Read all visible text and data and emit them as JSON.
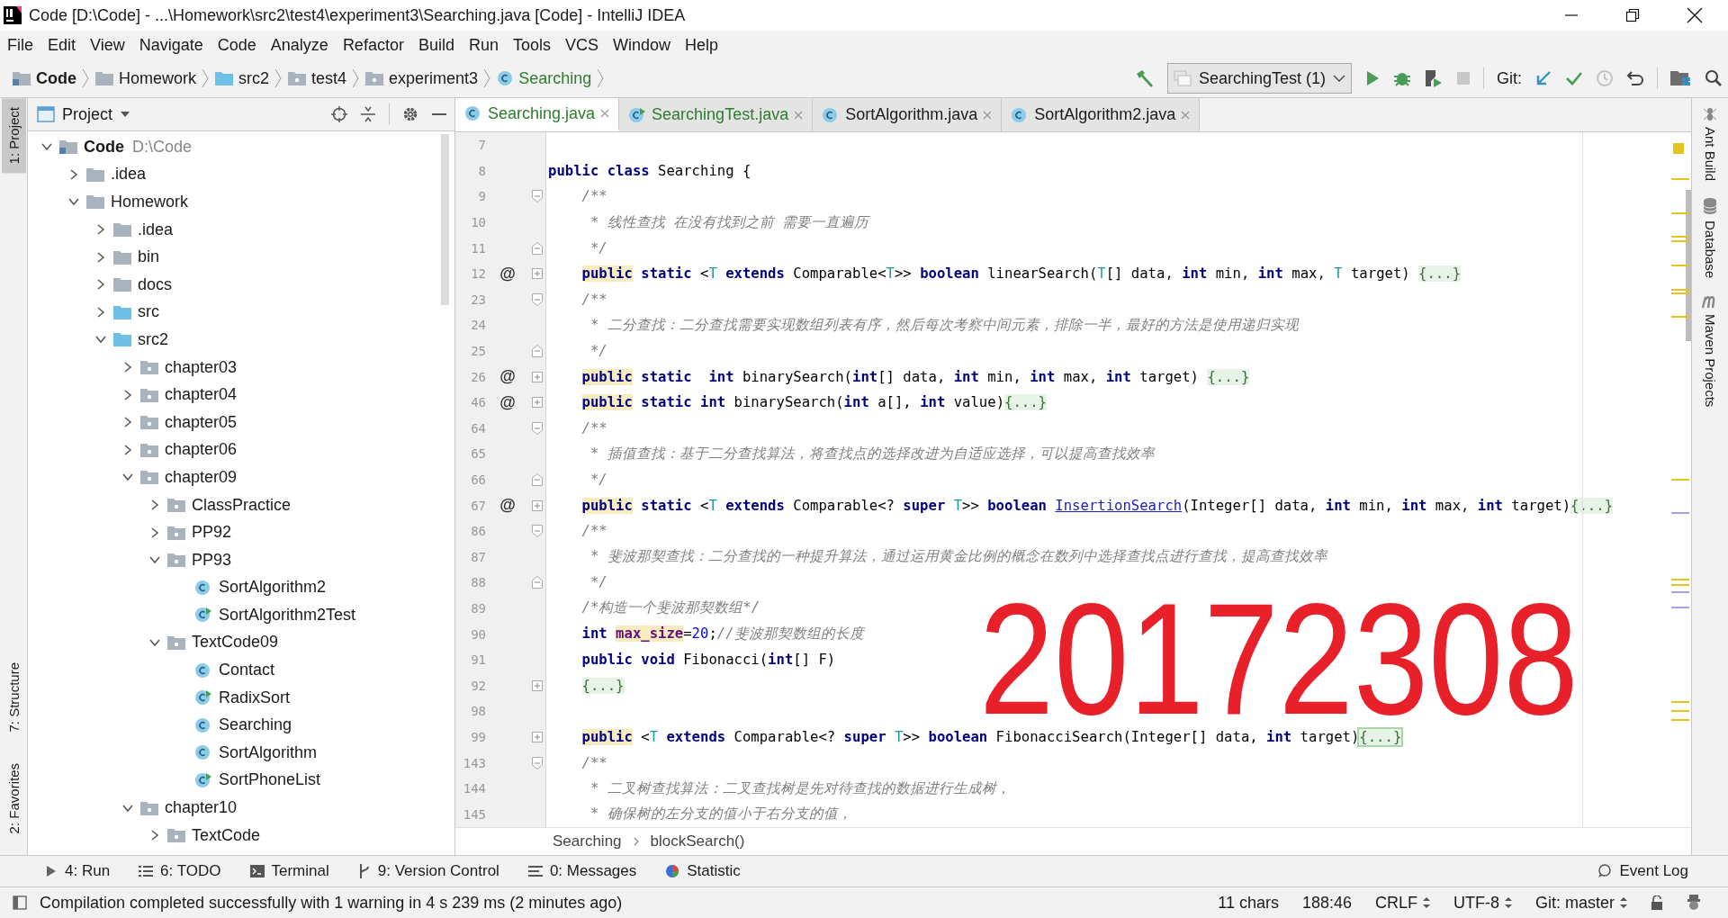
{
  "window": {
    "title": "Code [D:\\Code] - ...\\Homework\\src2\\test4\\experiment3\\Searching.java [Code] - IntelliJ IDEA"
  },
  "menu": [
    "File",
    "Edit",
    "View",
    "Navigate",
    "Code",
    "Analyze",
    "Refactor",
    "Build",
    "Run",
    "Tools",
    "VCS",
    "Window",
    "Help"
  ],
  "nav": {
    "crumbs": [
      {
        "label": "Code",
        "kind": "module"
      },
      {
        "label": "Homework",
        "kind": "folder"
      },
      {
        "label": "src2",
        "kind": "source"
      },
      {
        "label": "test4",
        "kind": "package"
      },
      {
        "label": "experiment3",
        "kind": "package"
      },
      {
        "label": "Searching",
        "kind": "class"
      }
    ],
    "run_config": "SearchingTest (1)",
    "git_label": "Git:"
  },
  "left_tools": [
    {
      "label": "1: Project",
      "selected": true
    },
    {
      "label": "7: Structure",
      "selected": false
    },
    {
      "label": "2: Favorites",
      "selected": false
    }
  ],
  "right_tools": [
    {
      "label": "Ant Build",
      "kind": "ant"
    },
    {
      "label": "Database",
      "kind": "database"
    },
    {
      "label": "Maven Projects",
      "kind": "maven"
    }
  ],
  "project": {
    "title": "Project",
    "tree": [
      {
        "label": "Code",
        "path": "D:\\Code",
        "kind": "module",
        "expanded": true,
        "children": [
          {
            "label": ".idea",
            "kind": "folder",
            "expanded": false
          },
          {
            "label": "Homework",
            "kind": "folder",
            "expanded": true,
            "children": [
              {
                "label": ".idea",
                "kind": "folder",
                "expanded": false
              },
              {
                "label": "bin",
                "kind": "folder",
                "expanded": false
              },
              {
                "label": "docs",
                "kind": "folder",
                "expanded": false
              },
              {
                "label": "src",
                "kind": "source",
                "expanded": false
              },
              {
                "label": "src2",
                "kind": "source",
                "expanded": true,
                "children": [
                  {
                    "label": "chapter03",
                    "kind": "package",
                    "expanded": false
                  },
                  {
                    "label": "chapter04",
                    "kind": "package",
                    "expanded": false
                  },
                  {
                    "label": "chapter05",
                    "kind": "package",
                    "expanded": false
                  },
                  {
                    "label": "chapter06",
                    "kind": "package",
                    "expanded": false
                  },
                  {
                    "label": "chapter09",
                    "kind": "package",
                    "expanded": true,
                    "children": [
                      {
                        "label": "ClassPractice",
                        "kind": "package",
                        "expanded": false
                      },
                      {
                        "label": "PP92",
                        "kind": "package",
                        "expanded": false
                      },
                      {
                        "label": "PP93",
                        "kind": "package",
                        "expanded": true,
                        "children": [
                          {
                            "label": "SortAlgorithm2",
                            "kind": "class"
                          },
                          {
                            "label": "SortAlgorithm2Test",
                            "kind": "test"
                          }
                        ]
                      },
                      {
                        "label": "TextCode09",
                        "kind": "package",
                        "expanded": true,
                        "children": [
                          {
                            "label": "Contact",
                            "kind": "class"
                          },
                          {
                            "label": "RadixSort",
                            "kind": "test"
                          },
                          {
                            "label": "Searching",
                            "kind": "class"
                          },
                          {
                            "label": "SortAlgorithm",
                            "kind": "class"
                          },
                          {
                            "label": "SortPhoneList",
                            "kind": "test"
                          }
                        ]
                      }
                    ]
                  },
                  {
                    "label": "chapter10",
                    "kind": "package",
                    "expanded": true,
                    "children": [
                      {
                        "label": "TextCode",
                        "kind": "package",
                        "expanded": false
                      }
                    ]
                  }
                ]
              }
            ]
          }
        ]
      }
    ]
  },
  "tabs": [
    {
      "label": "Searching.java",
      "kind": "class",
      "added": true,
      "selected": true
    },
    {
      "label": "SearchingTest.java",
      "kind": "test",
      "added": true,
      "selected": false
    },
    {
      "label": "SortAlgorithm.java",
      "kind": "class",
      "added": false,
      "selected": false
    },
    {
      "label": "SortAlgorithm2.java",
      "kind": "class",
      "added": false,
      "selected": false
    }
  ],
  "code": [
    {
      "n": "7",
      "kind": "plain"
    },
    {
      "n": "8",
      "kind": "plain",
      "indented": false,
      "tokens": [
        {
          "kind": "kw",
          "t": "public class"
        },
        {
          "kind": "tx",
          "t": " Searching {"
        }
      ]
    },
    {
      "n": "9",
      "kind": "fold-start",
      "indented": true,
      "tokens": [
        {
          "kind": "cm",
          "t": "/**"
        }
      ]
    },
    {
      "n": "10",
      "kind": "plain",
      "indented": true,
      "tokens": [
        {
          "kind": "cm",
          "t": " * 线性查找 在没有找到之前 需要一直遍历"
        }
      ]
    },
    {
      "n": "11",
      "kind": "fold-end",
      "indented": true,
      "tokens": [
        {
          "kind": "cm",
          "t": " */"
        }
      ]
    },
    {
      "n": "12",
      "mark": "@",
      "kind": "folded",
      "indented": true,
      "tokens": [
        {
          "kind": "kwh",
          "t": "public"
        },
        {
          "kind": "kw",
          "t": " static"
        },
        {
          "kind": "tx",
          "t": " <"
        },
        {
          "kind": "tp",
          "t": "T"
        },
        {
          "kind": "kw",
          "t": " extends"
        },
        {
          "kind": "tx",
          "t": " Comparable<"
        },
        {
          "kind": "tp",
          "t": "T"
        },
        {
          "kind": "tx",
          "t": ">> "
        },
        {
          "kind": "kw",
          "t": "boolean"
        },
        {
          "kind": "tx",
          "t": " linearSearch("
        },
        {
          "kind": "tp",
          "t": "T"
        },
        {
          "kind": "tx",
          "t": "[] data, "
        },
        {
          "kind": "kw",
          "t": "int"
        },
        {
          "kind": "tx",
          "t": " min, "
        },
        {
          "kind": "kw",
          "t": "int"
        },
        {
          "kind": "tx",
          "t": " max, "
        },
        {
          "kind": "tp",
          "t": "T"
        },
        {
          "kind": "tx",
          "t": " target) "
        },
        {
          "kind": "fold",
          "t": "{...}"
        }
      ]
    },
    {
      "n": "23",
      "kind": "fold-start",
      "indented": true,
      "tokens": [
        {
          "kind": "cm",
          "t": "/**"
        }
      ]
    },
    {
      "n": "24",
      "kind": "plain",
      "indented": true,
      "tokens": [
        {
          "kind": "cm",
          "t": " * 二分查找：二分查找需要实现数组列表有序，然后每次考察中间元素，排除一半，最好的方法是使用递归实现"
        }
      ]
    },
    {
      "n": "25",
      "kind": "fold-end",
      "indented": true,
      "tokens": [
        {
          "kind": "cm",
          "t": " */"
        }
      ]
    },
    {
      "n": "26",
      "mark": "@",
      "kind": "folded",
      "indented": true,
      "tokens": [
        {
          "kind": "kwh",
          "t": "public"
        },
        {
          "kind": "kw",
          "t": " static  int"
        },
        {
          "kind": "tx",
          "t": " binarySearch("
        },
        {
          "kind": "kw",
          "t": "int"
        },
        {
          "kind": "tx",
          "t": "[] data, "
        },
        {
          "kind": "kw",
          "t": "int"
        },
        {
          "kind": "tx",
          "t": " min, "
        },
        {
          "kind": "kw",
          "t": "int"
        },
        {
          "kind": "tx",
          "t": " max, "
        },
        {
          "kind": "kw",
          "t": "int"
        },
        {
          "kind": "tx",
          "t": " target) "
        },
        {
          "kind": "fold",
          "t": "{...}"
        }
      ]
    },
    {
      "n": "46",
      "mark": "@",
      "kind": "folded",
      "indented": true,
      "tokens": [
        {
          "kind": "kwh",
          "t": "public"
        },
        {
          "kind": "kw",
          "t": " static int"
        },
        {
          "kind": "tx",
          "t": " binarySearch("
        },
        {
          "kind": "kw",
          "t": "int"
        },
        {
          "kind": "tx",
          "t": " a[], "
        },
        {
          "kind": "kw",
          "t": "int"
        },
        {
          "kind": "tx",
          "t": " value)"
        },
        {
          "kind": "fold",
          "t": "{...}"
        }
      ]
    },
    {
      "n": "64",
      "kind": "fold-start",
      "indented": true,
      "tokens": [
        {
          "kind": "cm",
          "t": "/**"
        }
      ]
    },
    {
      "n": "65",
      "kind": "plain",
      "indented": true,
      "tokens": [
        {
          "kind": "cm",
          "t": " * 插值查找：基于二分查找算法，将查找点的选择改进为自适应选择，可以提高查找效率"
        }
      ]
    },
    {
      "n": "66",
      "kind": "fold-end",
      "indented": true,
      "tokens": [
        {
          "kind": "cm",
          "t": " */"
        }
      ]
    },
    {
      "n": "67",
      "mark": "@",
      "kind": "folded",
      "indented": true,
      "tokens": [
        {
          "kind": "kwh",
          "t": "public"
        },
        {
          "kind": "kw",
          "t": " static"
        },
        {
          "kind": "tx",
          "t": " <"
        },
        {
          "kind": "tp",
          "t": "T"
        },
        {
          "kind": "kw",
          "t": " extends"
        },
        {
          "kind": "tx",
          "t": " Comparable<? "
        },
        {
          "kind": "kw",
          "t": "super"
        },
        {
          "kind": "tp",
          "t": " T"
        },
        {
          "kind": "tx",
          "t": ">> "
        },
        {
          "kind": "kw",
          "t": "boolean "
        },
        {
          "kind": "link",
          "t": "InsertionSearch"
        },
        {
          "kind": "tx",
          "t": "(Integer[] data, "
        },
        {
          "kind": "kw",
          "t": "int"
        },
        {
          "kind": "tx",
          "t": " min, "
        },
        {
          "kind": "kw",
          "t": "int"
        },
        {
          "kind": "tx",
          "t": " max, "
        },
        {
          "kind": "kw",
          "t": "int"
        },
        {
          "kind": "tx",
          "t": " target)"
        },
        {
          "kind": "fold",
          "t": "{...}"
        }
      ]
    },
    {
      "n": "86",
      "kind": "fold-start",
      "indented": true,
      "tokens": [
        {
          "kind": "cm",
          "t": "/**"
        }
      ]
    },
    {
      "n": "87",
      "kind": "plain",
      "indented": true,
      "tokens": [
        {
          "kind": "cm",
          "t": " * 斐波那契查找：二分查找的一种提升算法，通过运用黄金比例的概念在数列中选择查找点进行查找，提高查找效率"
        }
      ]
    },
    {
      "n": "88",
      "kind": "fold-end",
      "indented": true,
      "tokens": [
        {
          "kind": "cm",
          "t": " */"
        }
      ]
    },
    {
      "n": "89",
      "kind": "plain",
      "indented": true,
      "tokens": [
        {
          "kind": "cm",
          "t": "/*构造一个斐波那契数组*/"
        }
      ]
    },
    {
      "n": "90",
      "kind": "plain",
      "indented": true,
      "tokens": [
        {
          "kind": "kw",
          "t": "int "
        },
        {
          "kind": "field",
          "t": "max_size"
        },
        {
          "kind": "tx",
          "t": "="
        },
        {
          "kind": "num",
          "t": "20"
        },
        {
          "kind": "tx",
          "t": ";"
        },
        {
          "kind": "cm",
          "t": "//斐波那契数组的长度"
        }
      ]
    },
    {
      "n": "91",
      "kind": "plain",
      "indented": true,
      "tokens": [
        {
          "kind": "kw",
          "t": "public void"
        },
        {
          "kind": "tx",
          "t": " Fibonacci("
        },
        {
          "kind": "kw",
          "t": "int"
        },
        {
          "kind": "tx",
          "t": "[] F)"
        }
      ]
    },
    {
      "n": "92",
      "kind": "folded",
      "indented": true,
      "tokens": [
        {
          "kind": "fold",
          "t": "{...}"
        }
      ]
    },
    {
      "n": "98",
      "kind": "plain"
    },
    {
      "n": "99",
      "kind": "folded",
      "indented": true,
      "tokens": [
        {
          "kind": "kwh",
          "t": "public"
        },
        {
          "kind": "tx",
          "t": " <"
        },
        {
          "kind": "tp",
          "t": "T"
        },
        {
          "kind": "kw",
          "t": " extends"
        },
        {
          "kind": "tx",
          "t": " Comparable<? "
        },
        {
          "kind": "kw",
          "t": "super"
        },
        {
          "kind": "tp",
          "t": " T"
        },
        {
          "kind": "tx",
          "t": ">> "
        },
        {
          "kind": "kw",
          "t": "boolean"
        },
        {
          "kind": "tx",
          "t": " FibonacciSearch(Integer[] data, "
        },
        {
          "kind": "kw",
          "t": "int"
        },
        {
          "kind": "tx",
          "t": " target)"
        },
        {
          "kind": "foldsel",
          "t": "{...}"
        }
      ]
    },
    {
      "n": "143",
      "kind": "fold-start",
      "indented": true,
      "tokens": [
        {
          "kind": "cm",
          "t": "/**"
        }
      ]
    },
    {
      "n": "144",
      "kind": "plain",
      "indented": true,
      "tokens": [
        {
          "kind": "cm",
          "t": " * 二叉树查找算法：二叉查找树是先对待查找的数据进行生成树，"
        }
      ]
    },
    {
      "n": "145",
      "kind": "plain",
      "indented": true,
      "tokens": [
        {
          "kind": "cm",
          "t": " * 确保树的左分支的值小于右分支的值，"
        }
      ]
    }
  ],
  "overlay_text": "20172308",
  "editor_breadcrumb": [
    "Searching",
    "blockSearch()"
  ],
  "bottom_tools": [
    {
      "label": "4: Run",
      "kind": "run"
    },
    {
      "label": "6: TODO",
      "kind": "todo"
    },
    {
      "label": "Terminal",
      "kind": "terminal"
    },
    {
      "label": "9: Version Control",
      "kind": "vcs"
    },
    {
      "label": "0: Messages",
      "kind": "messages"
    },
    {
      "label": "Statistic",
      "kind": "statistic"
    },
    {
      "label": "Event Log",
      "kind": "eventlog"
    }
  ],
  "status": {
    "message": "Compilation completed successfully with 1 warning in 4 s 239 ms (2 minutes ago)",
    "items": [
      {
        "text": "11 chars",
        "kind": "plain"
      },
      {
        "text": "188:46",
        "kind": "plain"
      },
      {
        "text": "CRLF",
        "kind": "select"
      },
      {
        "text": "UTF-8",
        "kind": "select"
      },
      {
        "text": "Git: master",
        "kind": "select"
      }
    ]
  }
}
